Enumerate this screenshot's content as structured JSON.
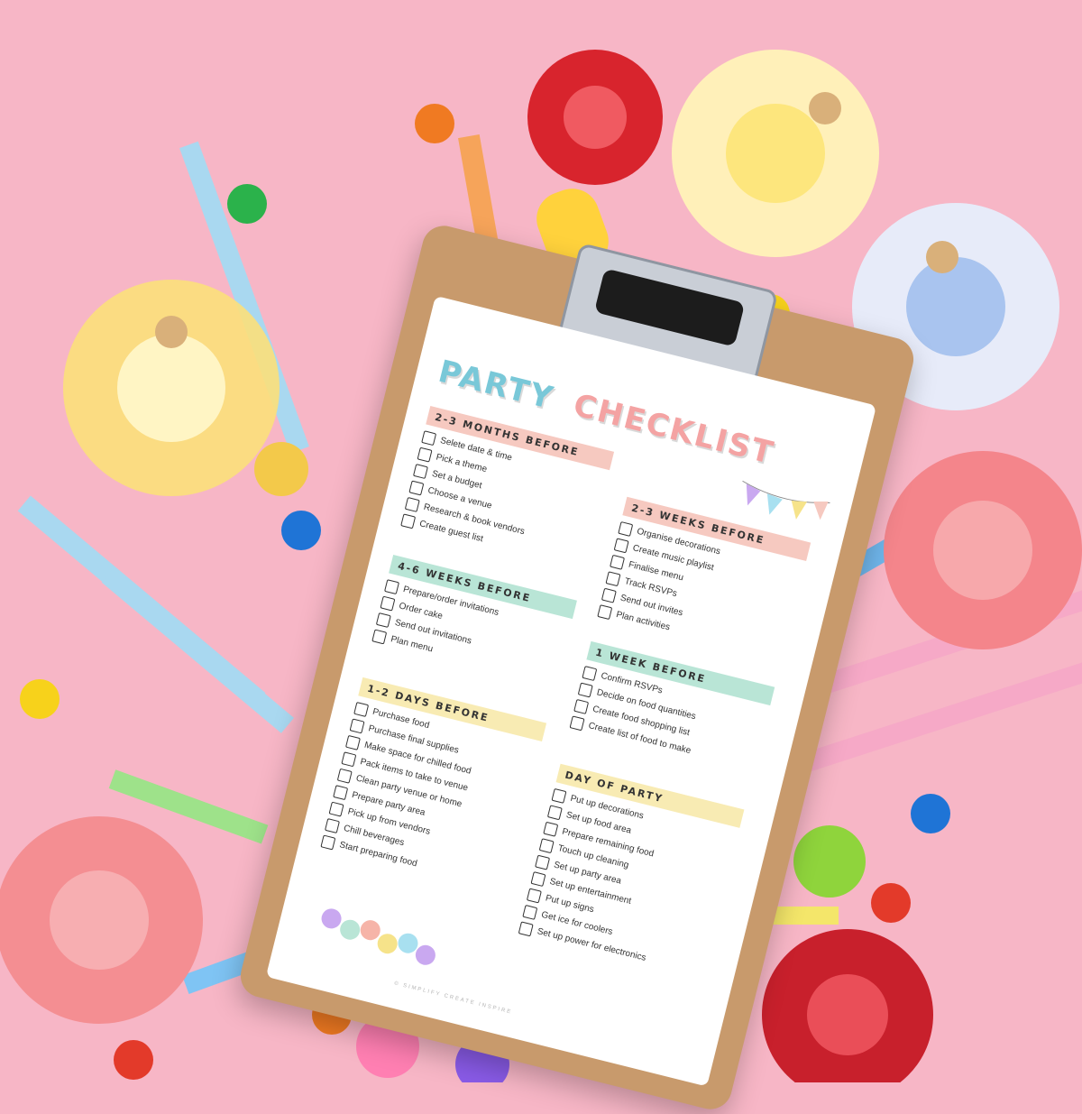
{
  "checklist": {
    "title_line1": "PARTY",
    "title_line2": "CHECKLIST",
    "copyright": "© SIMPLIFY CREATE INSPIRE",
    "sections": [
      {
        "heading": "2-3 MONTHS BEFORE",
        "items": [
          "Selete date & time",
          "Pick a theme",
          "Set a budget",
          "Choose a venue",
          "Research & book vendors",
          "Create guest list"
        ]
      },
      {
        "heading": "2-3 WEEKS BEFORE",
        "items": [
          "Organise decorations",
          "Create music playlist",
          "Finalise menu",
          "Track RSVPs",
          "Send out invites",
          "Plan activities"
        ]
      },
      {
        "heading": "4-6 WEEKS BEFORE",
        "items": [
          "Prepare/order invitations",
          "Order cake",
          "Send out invitations",
          "Plan menu"
        ]
      },
      {
        "heading": "1 WEEK BEFORE",
        "items": [
          "Confirm RSVPs",
          "Decide on food quantities",
          "Create food shopping list",
          "Create list of food to make"
        ]
      },
      {
        "heading": "1-2 DAYS BEFORE",
        "items": [
          "Purchase food",
          "Purchase final supplies",
          "Make space for chilled food",
          "Pack items to take to venue",
          "Clean party venue or home",
          "Prepare party area",
          "Pick up from vendors",
          "Chill beverages",
          "Start preparing food"
        ]
      },
      {
        "heading": "DAY OF PARTY",
        "items": [
          "Put up decorations",
          "Set up food area",
          "Prepare remaining food",
          "Touch up cleaning",
          "Set up party area",
          "Set up entertainment",
          "Put up signs",
          "Get ice for coolers",
          "Set up power for electronics"
        ]
      }
    ]
  },
  "colors": {
    "background": "#f7b6c6",
    "section_pink": "#f6c9c0",
    "section_green": "#b9e5d6",
    "section_yellow": "#f8ebb3"
  },
  "decorations": {
    "icons": [
      "pinwheel-icon",
      "gift-bow-icon",
      "candle-icon",
      "candy-icon",
      "straw-icon",
      "balloon-icon"
    ]
  }
}
